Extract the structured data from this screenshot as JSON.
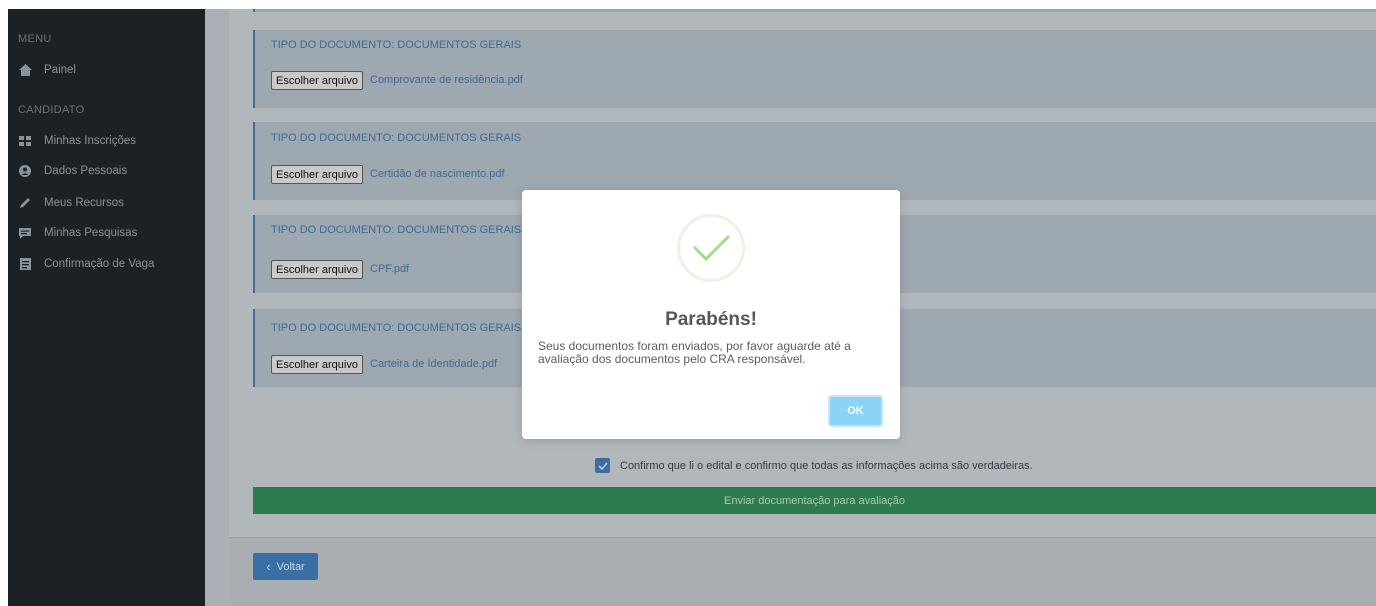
{
  "sidebar": {
    "menu_header": "MENU",
    "panel_label": "Painel",
    "candidate_header": "CANDIDATO",
    "items": [
      {
        "label": "Minhas Inscrições",
        "icon": "grid-icon"
      },
      {
        "label": "Dados Pessoais",
        "icon": "user-circle-icon"
      },
      {
        "label": "Meus Recursos",
        "icon": "pencil-icon"
      },
      {
        "label": "Minhas Pesquisas",
        "icon": "comment-icon"
      },
      {
        "label": "Confirmação de Vaga",
        "icon": "document-icon"
      }
    ]
  },
  "documents": [
    {
      "type_label": "TIPO DO DOCUMENTO: DOCUMENTOS GERAIS",
      "button_label": "Escolher arquivo",
      "file_name": "Comprovante de residência.pdf"
    },
    {
      "type_label": "TIPO DO DOCUMENTO: DOCUMENTOS GERAIS",
      "button_label": "Escolher arquivo",
      "file_name": "Certidão de nascimento.pdf"
    },
    {
      "type_label": "TIPO DO DOCUMENTO: DOCUMENTOS GERAIS",
      "button_label": "Escolher arquivo",
      "file_name": "CPF.pdf"
    },
    {
      "type_label": "TIPO DO DOCUMENTO: DOCUMENTOS GERAIS",
      "button_label": "Escolher arquivo",
      "file_name": "Carteira de Identidade.pdf"
    }
  ],
  "confirm": {
    "label": "Confirmo que li o edital e confirmo que todas as informações acima são verdadeiras.",
    "checked": true
  },
  "submit_label": "Enviar documentação para avaliação",
  "back_label": "Voltar",
  "modal": {
    "title": "Parabéns!",
    "message": "Seus documentos foram enviados, por favor aguarde até a avaliação dos documentos pelo CRA responsável.",
    "ok_label": "OK",
    "icon": "success-check-icon"
  },
  "colors": {
    "sidebar_bg": "#1c2126",
    "success_green": "#a5dc86",
    "submit_green": "#2e7c4d",
    "ok_button": "#8cd4f5",
    "primary_blue": "#3a6fa6"
  }
}
